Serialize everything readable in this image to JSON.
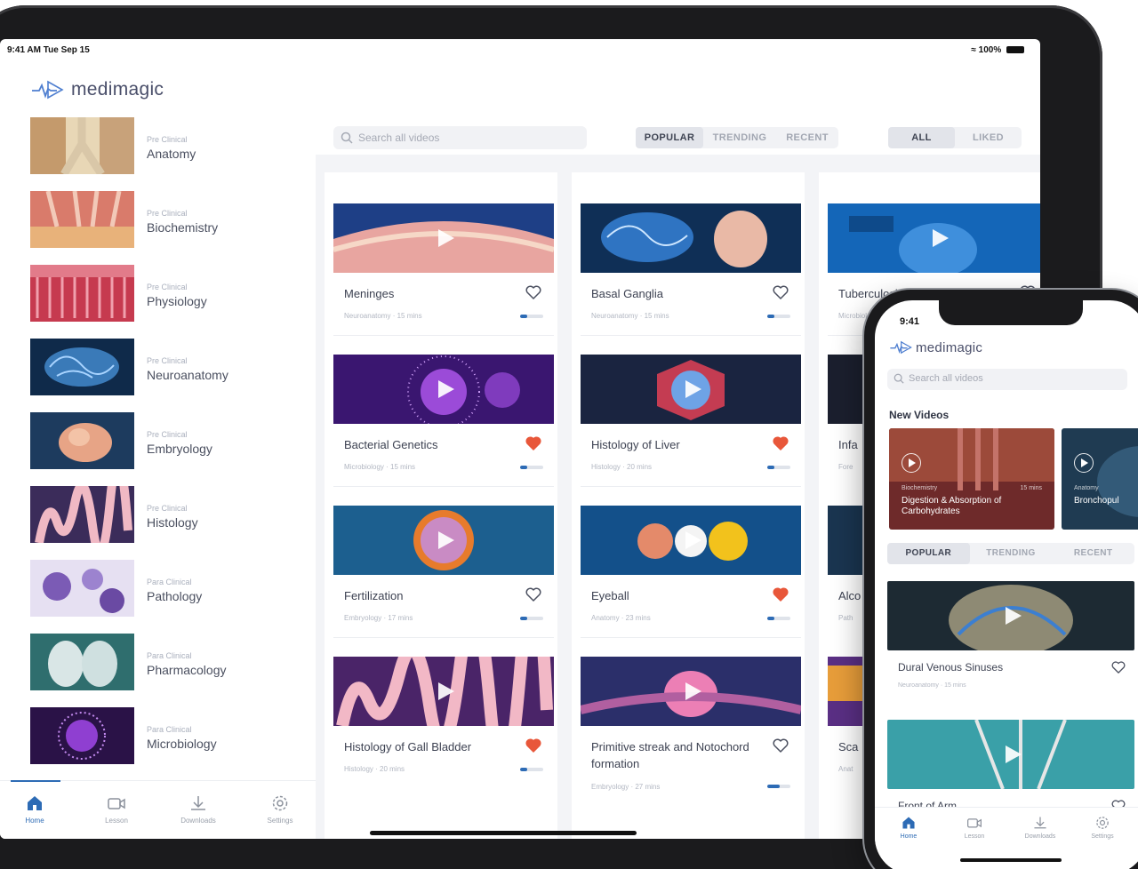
{
  "ipad": {
    "status": {
      "time": "9:41 AM  Tue Sep 15",
      "battery": "100%"
    },
    "brand": "medimagic",
    "subjects": [
      {
        "category": "Pre Clinical",
        "name": "Anatomy"
      },
      {
        "category": "Pre Clinical",
        "name": "Biochemistry"
      },
      {
        "category": "Pre Clinical",
        "name": "Physiology"
      },
      {
        "category": "Pre Clinical",
        "name": "Neuroanatomy"
      },
      {
        "category": "Pre Clinical",
        "name": "Embryology"
      },
      {
        "category": "Pre Clinical",
        "name": "Histology"
      },
      {
        "category": "Para Clinical",
        "name": "Pathology"
      },
      {
        "category": "Para Clinical",
        "name": "Pharmacology"
      },
      {
        "category": "Para Clinical",
        "name": "Microbiology"
      }
    ],
    "tabs": [
      {
        "label": "Home",
        "icon": "home-icon",
        "active": true
      },
      {
        "label": "Lesson",
        "icon": "video-camera-icon",
        "active": false
      },
      {
        "label": "Downloads",
        "icon": "download-icon",
        "active": false
      },
      {
        "label": "Settings",
        "icon": "gear-icon",
        "active": false
      }
    ],
    "search_placeholder": "Search all videos",
    "sort_options": [
      "POPULAR",
      "TRENDING",
      "RECENT"
    ],
    "sort_selected": "POPULAR",
    "filter_options": [
      "ALL",
      "LIKED"
    ],
    "filter_selected": "ALL",
    "videos": [
      {
        "title": "Meninges",
        "meta": "Neuroanatomy · 15 mins",
        "liked": false,
        "progress": 0.3
      },
      {
        "title": "Basal Ganglia",
        "meta": "Neuroanatomy · 15 mins",
        "liked": false,
        "progress": 0.3
      },
      {
        "title": "Tuberculosis",
        "meta": "Microbiology · 17 mins",
        "liked": false,
        "progress": 0.85
      },
      {
        "title": "Bacterial Genetics",
        "meta": "Microbiology · 15 mins",
        "liked": true,
        "progress": 0.3
      },
      {
        "title": "Histology of Liver",
        "meta": "Histology · 20 mins",
        "liked": true,
        "progress": 0.3
      },
      {
        "title": "Infa",
        "meta": "Fore",
        "liked": false,
        "progress": 0
      },
      {
        "title": "Fertilization",
        "meta": "Embryology · 17 mins",
        "liked": false,
        "progress": 0.3
      },
      {
        "title": "Eyeball",
        "meta": "Anatomy · 23 mins",
        "liked": true,
        "progress": 0.3
      },
      {
        "title": "Alco",
        "meta": "Path",
        "liked": false,
        "progress": 0
      },
      {
        "title": "Histology of Gall Bladder",
        "meta": "Histology · 20 mins",
        "liked": true,
        "progress": 0.3
      },
      {
        "title": "Primitive streak and Notochord formation",
        "meta": "Embryology · 27 mins",
        "liked": false,
        "progress": 0.55
      },
      {
        "title": "Sca",
        "meta": "Anat",
        "liked": false,
        "progress": 0
      }
    ]
  },
  "iphone": {
    "time": "9:41",
    "brand": "medimagic",
    "search_placeholder": "Search all videos",
    "section_title": "New Videos",
    "new_videos": [
      {
        "category": "Biochemistry",
        "title": "Digestion & Absorption of Carbohydrates",
        "duration": "15 mins"
      },
      {
        "category": "Anatomy",
        "title": "Bronchopul",
        "duration": ""
      }
    ],
    "sort_options": [
      "POPULAR",
      "TRENDING",
      "RECENT"
    ],
    "sort_selected": "POPULAR",
    "videos": [
      {
        "title": "Dural Venous Sinuses",
        "meta": "Neuroanatomy · 15 mins",
        "liked": false
      },
      {
        "title": "Front of Arm",
        "meta": "",
        "liked": false
      }
    ],
    "tabs": [
      {
        "label": "Home",
        "icon": "home-icon",
        "active": true
      },
      {
        "label": "Lesson",
        "icon": "video-camera-icon",
        "active": false
      },
      {
        "label": "Downloads",
        "icon": "download-icon",
        "active": false
      },
      {
        "label": "Settings",
        "icon": "gear-icon",
        "active": false
      }
    ]
  },
  "colors": {
    "accent": "#2d6bb5",
    "heart_liked": "#e8573a",
    "brand_text": "#4a4f6a"
  }
}
